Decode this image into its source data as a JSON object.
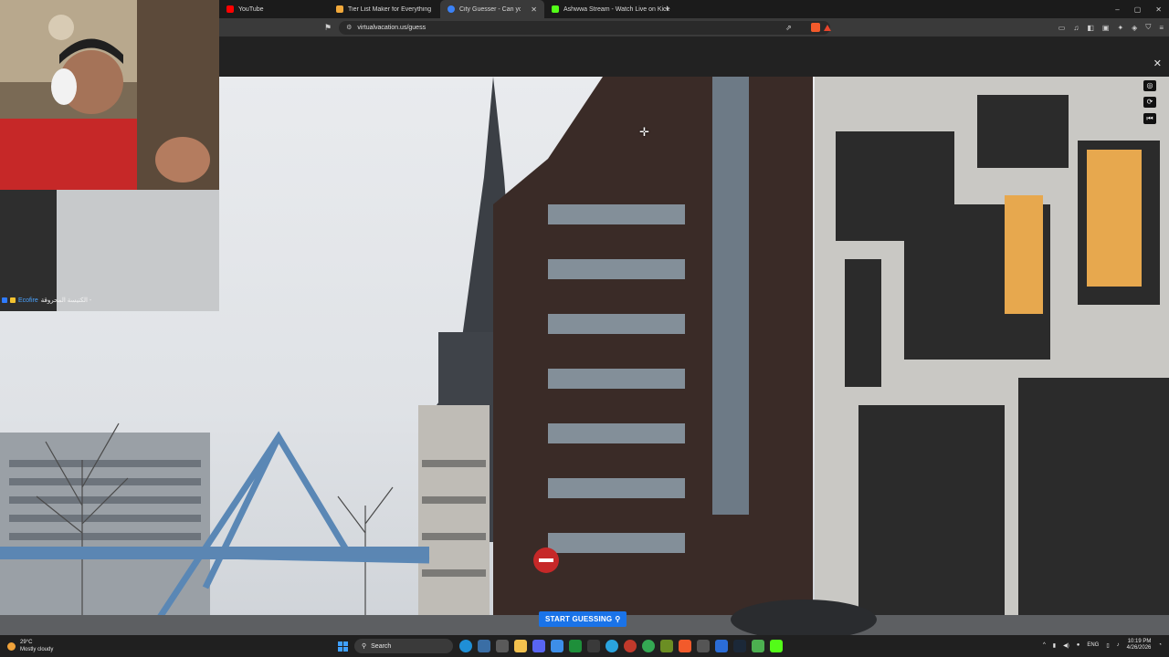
{
  "browser": {
    "tabs": [
      {
        "title": "YouTube",
        "color": "#ff0000",
        "active": false
      },
      {
        "title": "Tier List Maker for Everything - TierM",
        "color": "#f2a93b",
        "active": false
      },
      {
        "title": "City Guesser - Can you guess",
        "color": "#3b82f6",
        "active": true
      },
      {
        "title": "Ashwwa Stream - Watch Live on Kick",
        "color": "#53fc18",
        "active": false
      }
    ],
    "new_tab": "+",
    "window_controls": [
      "–",
      "▢",
      "✕"
    ],
    "url": "virtualvacation.us/guess",
    "close_overlay": "✕"
  },
  "stream": {
    "chat_name": "Ecofire",
    "chat_message": "الكنيسة المحروقة -"
  },
  "game": {
    "start_button": "START GUESSING",
    "start_icon": "map-pin-icon",
    "controls": [
      "◎",
      "⟳",
      "⏮"
    ]
  },
  "taskbar": {
    "weather_temp": "29°C",
    "weather_desc": "Mostly cloudy",
    "search_placeholder": "Search",
    "language": "ENG",
    "time": "10:19 PM",
    "date": "4/26/2026"
  }
}
